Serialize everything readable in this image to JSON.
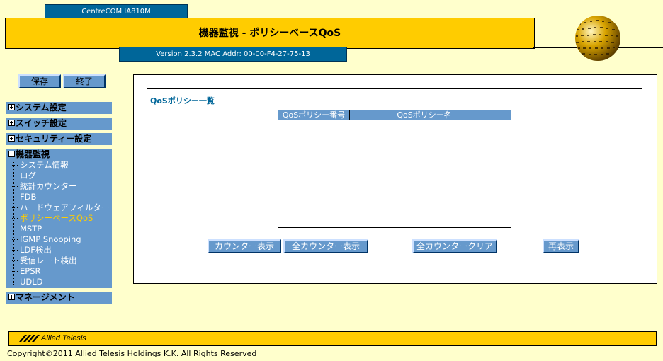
{
  "header": {
    "model": "CentreCOM IA810M",
    "title": "機器監視 - ポリシーベースQoS",
    "version": "Version 2.3.2 MAC Addr: 00-00-F4-27-75-13"
  },
  "actions": {
    "save": "保存",
    "exit": "終了"
  },
  "menu": {
    "system": "システム設定",
    "switch": "スイッチ設定",
    "security": "セキュリティー設定",
    "monitor": "機器監視",
    "monitor_items": [
      "システム情報",
      "ログ",
      "統計カウンター",
      "FDB",
      "ハードウェアフィルター",
      "ポリシーベースQoS",
      "MSTP",
      "IGMP Snooping",
      "LDF検出",
      "受信レート検出",
      "EPSR",
      "UDLD"
    ],
    "active_item": "ポリシーベースQoS",
    "management": "マネージメント"
  },
  "content": {
    "section_title": "QoSポリシー一覧",
    "columns": [
      "QoSポリシー番号",
      "QoSポリシー名"
    ],
    "rows": [],
    "buttons": {
      "counter_display": "カウンター表示",
      "all_counter_display": "全カウンター表示",
      "all_counter_clear": "全カウンタークリア",
      "refresh": "再表示"
    }
  },
  "footer": {
    "brand": "Allied Telesis",
    "copyright": "Copyright©2011 Allied Telesis Holdings K.K. All Rights Reserved"
  },
  "colors": {
    "accent_yellow": "#ffcc00",
    "header_blue": "#006699",
    "menu_blue": "#6699cc",
    "background": "#ffffcc"
  }
}
